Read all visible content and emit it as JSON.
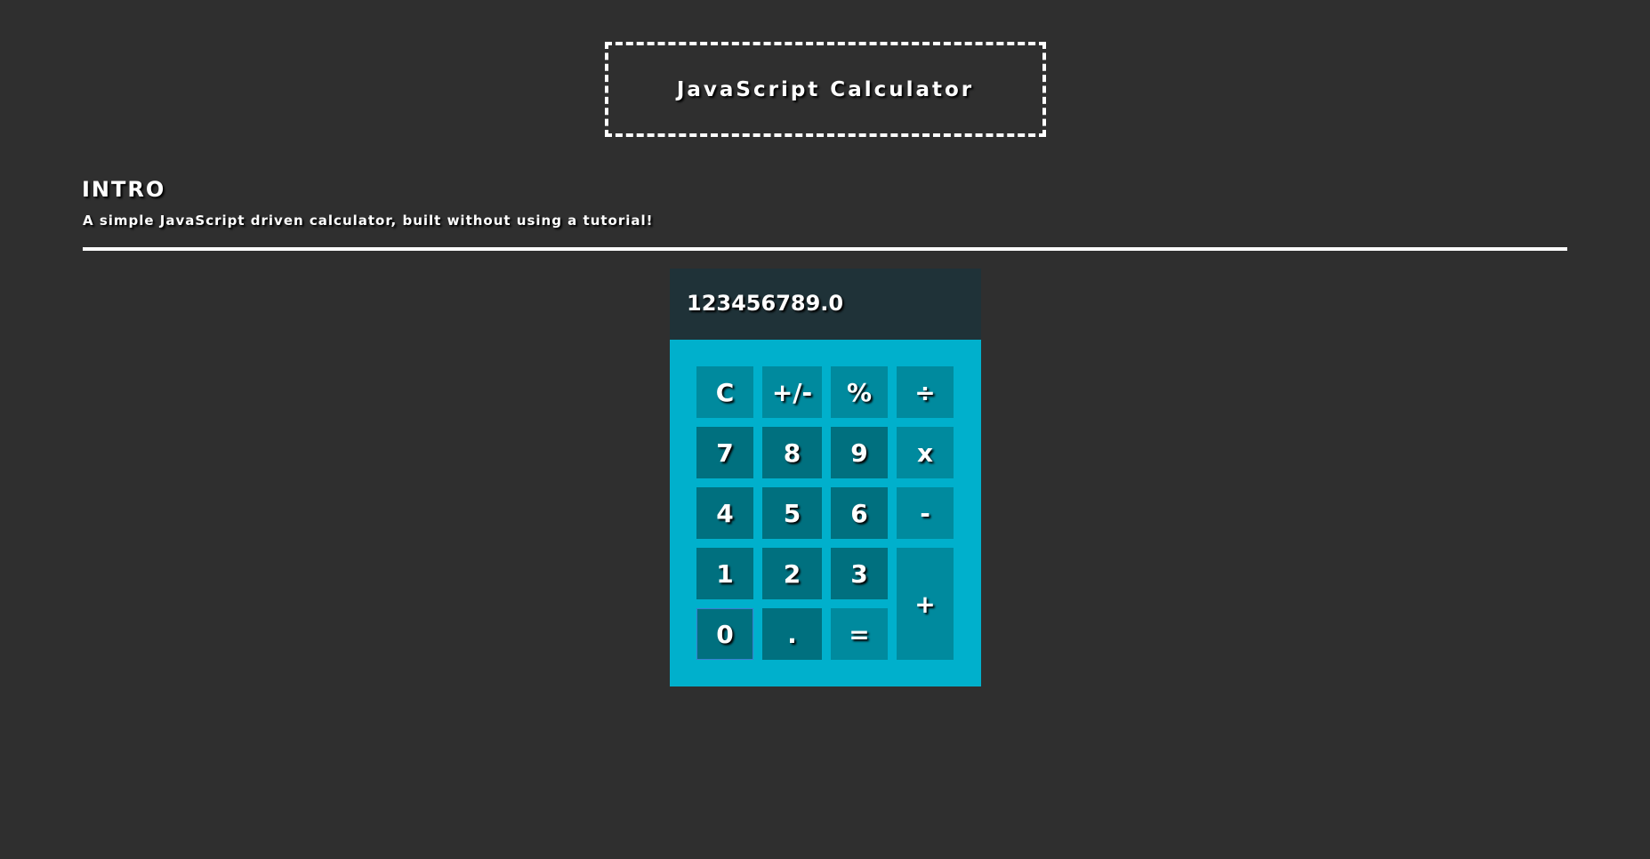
{
  "header": {
    "title": "JavaScript Calculator"
  },
  "intro": {
    "heading": "INTRO",
    "text": "A simple JavaScript driven calculator, built without using a tutorial!"
  },
  "calculator": {
    "display": "123456789.0",
    "keys": {
      "clear": "C",
      "sign": "+/-",
      "percent": "%",
      "divide": "÷",
      "seven": "7",
      "eight": "8",
      "nine": "9",
      "multiply": "x",
      "four": "4",
      "five": "5",
      "six": "6",
      "minus": "-",
      "one": "1",
      "two": "2",
      "three": "3",
      "plus": "+",
      "zero": "0",
      "decimal": ".",
      "equals": "="
    }
  },
  "colors": {
    "background": "#2f2f2f",
    "display": "#1f3238",
    "keypad": "#00b0cc",
    "key_light": "#008a9e",
    "key_dark": "#00707f"
  }
}
